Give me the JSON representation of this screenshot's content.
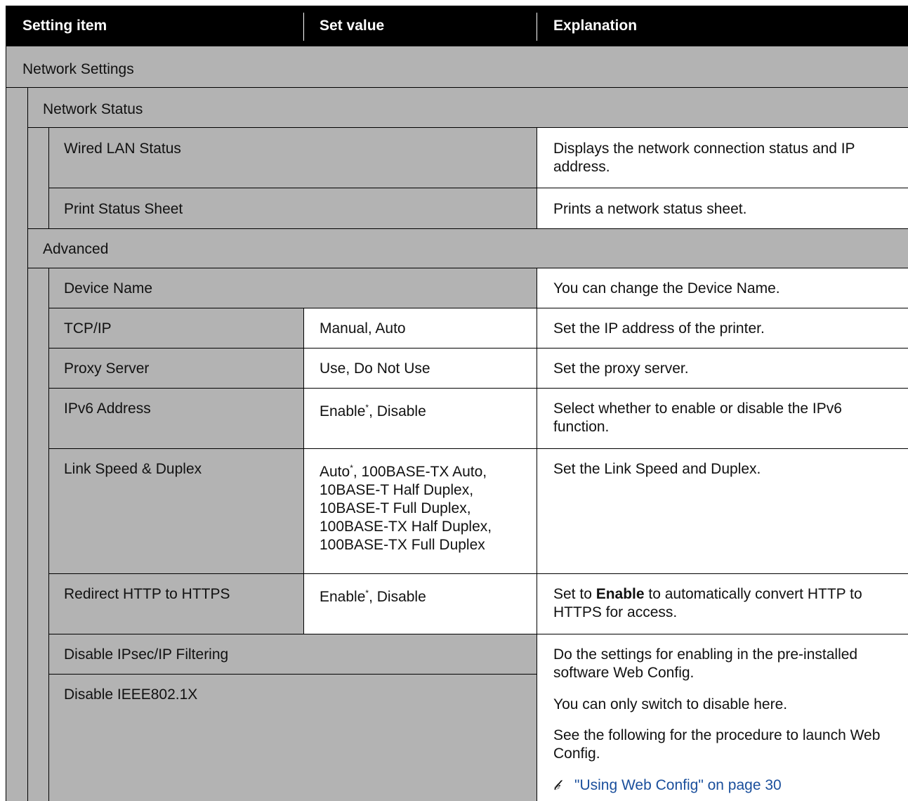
{
  "header": {
    "col1": "Setting item",
    "col2": "Set value",
    "col3": "Explanation"
  },
  "rows": {
    "network_settings": "Network Settings",
    "network_status": "Network Status",
    "wired_lan": {
      "item": "Wired LAN Status",
      "explanation": "Displays the network connection status and IP address."
    },
    "print_status": {
      "item": "Print Status Sheet",
      "explanation": "Prints a network status sheet."
    },
    "advanced": "Advanced",
    "device_name": {
      "item": "Device Name",
      "explanation": "You can change the Device Name."
    },
    "tcpip": {
      "item": "TCP/IP",
      "value": "Manual, Auto",
      "explanation": "Set the IP address of the printer."
    },
    "proxy": {
      "item": "Proxy Server",
      "value": "Use, Do Not Use",
      "explanation": "Set the proxy server."
    },
    "ipv6": {
      "item": "IPv6 Address",
      "value_a": "Enable",
      "value_star": "*",
      "value_b": ", Disable",
      "explanation": "Select whether to enable or disable the IPv6 function."
    },
    "link_speed": {
      "item": "Link Speed & Duplex",
      "value_first": "Auto",
      "value_star": "*",
      "value_first_rest": ", 100BASE-TX Auto,",
      "value_lines": [
        "10BASE-T Half Duplex,",
        "10BASE-T Full Duplex,",
        "100BASE-TX Half Duplex,",
        "100BASE-TX Full Duplex"
      ],
      "explanation": "Set the Link Speed and Duplex."
    },
    "redirect": {
      "item": "Redirect HTTP to HTTPS",
      "value_a": "Enable",
      "value_star": "*",
      "value_b": ", Disable",
      "expl_pre": "Set to ",
      "expl_bold": "Enable",
      "expl_post": " to automatically convert HTTP to HTTPS for access."
    },
    "disable_ipsec": {
      "item": "Disable IPsec/IP Filtering"
    },
    "disable_ieee": {
      "item": "Disable IEEE802.1X"
    },
    "disable_expl": {
      "p1": "Do the settings for enabling in the pre-installed software Web Config.",
      "p2": "You can only switch to disable here.",
      "p3": "See the following for the procedure to launch Web Config.",
      "link_icon": "𝒷",
      "link": "\"Using Web Config\" on page 30"
    }
  }
}
